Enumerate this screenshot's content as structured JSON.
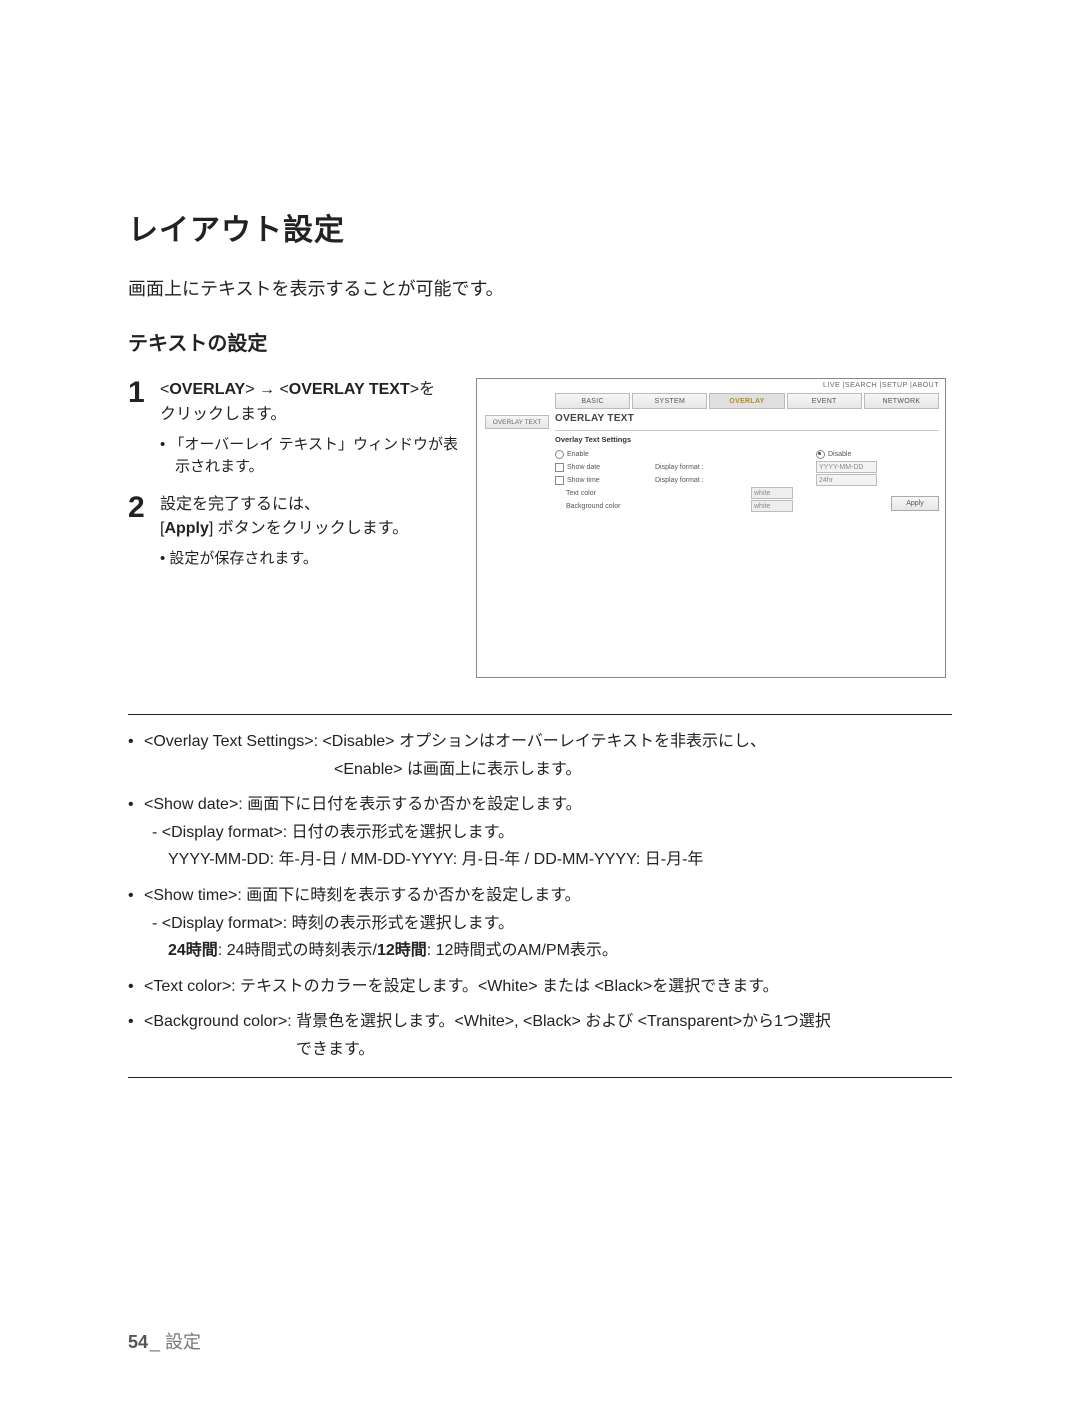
{
  "title": "レイアウト設定",
  "lead": "画面上にテキストを表示することが可能です。",
  "subtitle": "テキストの設定",
  "steps": {
    "s1": {
      "num": "1",
      "pre": "<",
      "k1": "OVERLAY",
      "arrow": "> → <",
      "k2": "OVERLAY TEXT",
      "post": ">を",
      "line2": "クリックします。",
      "sub1": "「オーバーレイ テキスト」ウィンドウが表示されます。"
    },
    "s2": {
      "num": "2",
      "line1": "設定を完了するには、",
      "line2a": "[",
      "key": "Apply",
      "line2b": "] ボタンをクリックします。",
      "sub1": "設定が保存されます。"
    }
  },
  "mock": {
    "topright": "LIVE  |SEARCH |SETUP |ABOUT",
    "tab1": "BASIC",
    "tab2": "SYSTEM",
    "tab3": "OVERLAY",
    "tab4": "EVENT",
    "tab5": "NETWORK",
    "sidebtn": "OVERLAY TEXT",
    "ptitle": "OVERLAY TEXT",
    "sub": "Overlay Text Settings",
    "enable": "Enable",
    "disable": "Disable",
    "showdate": "Show date",
    "showtime": "Show time",
    "dformat": "Display format :",
    "textcolor": "Text color",
    "bgcolor": "Background color",
    "white": "white",
    "sel1": "YYYY-MM-DD",
    "sel2": "24hr",
    "apply": "Apply"
  },
  "defs": {
    "d1a": "<Overlay Text Settings>: <Disable> オプションはオーバーレイテキストを非表示にし、",
    "d1b": "<Enable> は画面上に表示します。",
    "d2": "<Show date>: 画面下に日付を表示するか否かを設定します。",
    "d2s": " - <Display format>: 日付の表示形式を選択します。",
    "d2s2": "YYYY-MM-DD: 年-月-日 / MM-DD-YYYY: 月-日-年 / DD-MM-YYYY: 日-月-年",
    "d3": "<Show time>: 画面下に時刻を表示するか否かを設定します。",
    "d3s": " - <Display format>: 時刻の表示形式を選択します。",
    "d3s2a": "24時間",
    "d3s2b": ": 24時間式の時刻表示/",
    "d3s2c": "12時間",
    "d3s2d": ": 12時間式のAM/PM表示。",
    "d4": "<Text color>: テキストのカラーを設定します。<White> または <Black>を選択できます。",
    "d5a": "<Background color>: 背景色を選択します。<White>, <Black> および <Transparent>から1つ選択",
    "d5b": "できます。"
  },
  "footer": {
    "page": "54",
    "sep": "_ ",
    "label": "設定"
  }
}
